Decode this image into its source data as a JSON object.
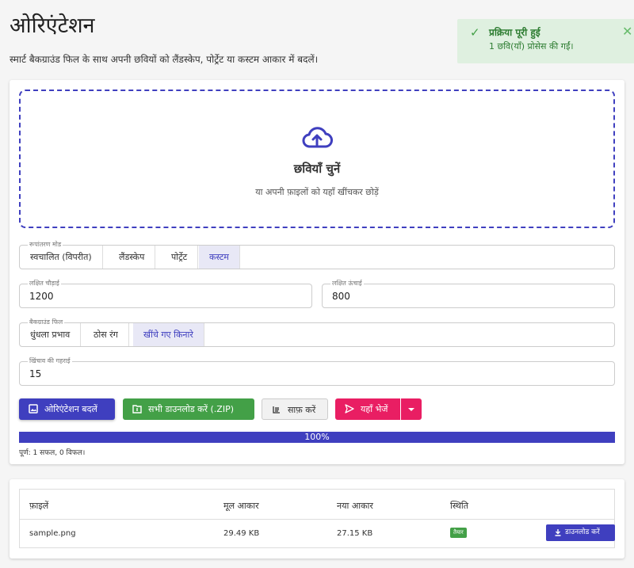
{
  "header": {
    "title": "ओरिएंटेशन",
    "subtitle": "स्मार्ट बैकग्राउंड फिल के साथ अपनी छवियों को लैंडस्केप, पोर्ट्रेट या कस्टम आकार में बदलें।"
  },
  "toast": {
    "title": "प्रक्रिया पूरी हुई",
    "message": "1 छवि(याँ) प्रोसेस की गईं।",
    "close": "✕",
    "check": "✓"
  },
  "dropzone": {
    "title": "छवियाँ चुनें",
    "hint": "या अपनी फ़ाइलों को यहाँ खींचकर छोड़ें"
  },
  "mode": {
    "legend": "रूपांतरण मोड",
    "options": [
      "स्वचालित (विपरीत)",
      "लैंडस्केप",
      "पोर्ट्रेट",
      "कस्टम"
    ],
    "selected": "कस्टम"
  },
  "width": {
    "legend": "लक्षित चौड़ाई",
    "value": "1200"
  },
  "height": {
    "legend": "लक्षित ऊंचाई",
    "value": "800"
  },
  "fill": {
    "legend": "बैकग्राउंड फिल",
    "options": [
      "धुंधला प्रभाव",
      "ठोस रंग",
      "खींचे गए किनारे"
    ],
    "selected": "खींचे गए किनारे"
  },
  "depth": {
    "legend": "खिंचाव की गहराई",
    "value": "15"
  },
  "actions": {
    "convert": "ओरिएंटेशन बदलें",
    "download_zip": "सभी डाउनलोड करें (.ZIP)",
    "clear": "साफ़ करें",
    "send": "यहाँ भेजें"
  },
  "progress": {
    "value": 100,
    "label": "100%",
    "status": "पूर्ण: 1 सफल, 0 विफल।"
  },
  "table": {
    "headers": [
      "फ़ाइलें",
      "मूल आकार",
      "नया आकार",
      "स्थिति"
    ],
    "rows": [
      {
        "name": "sample.png",
        "original": "29.49 KB",
        "new": "27.15 KB",
        "status": "तैयार",
        "action": "डाउनलोड करें"
      }
    ]
  },
  "colors": {
    "accent": "#3f3fbf",
    "success": "#43a047",
    "pink": "#e91e63"
  }
}
